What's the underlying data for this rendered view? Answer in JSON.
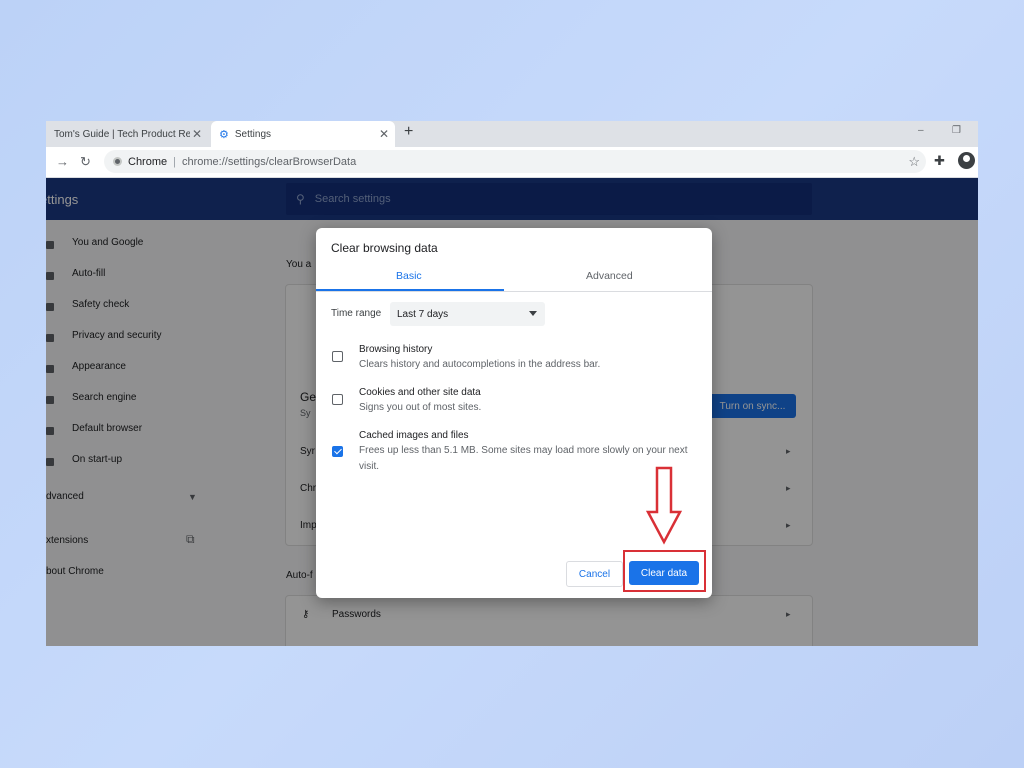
{
  "tabs": [
    {
      "label": "Tom's Guide | Tech Product Revie",
      "close": "✕"
    },
    {
      "label": "Settings",
      "close": "✕"
    }
  ],
  "new_tab": "+",
  "window_controls": {
    "minimize": "–",
    "restore": "❐"
  },
  "omnibox": {
    "site": "Chrome",
    "separator": "|",
    "url": "chrome://settings/clearBrowserData"
  },
  "settings": {
    "title": "ettings",
    "search_placeholder": "Search settings",
    "nav": [
      {
        "label": "You and Google"
      },
      {
        "label": "Auto-fill"
      },
      {
        "label": "Safety check"
      },
      {
        "label": "Privacy and security"
      },
      {
        "label": "Appearance"
      },
      {
        "label": "Search engine"
      },
      {
        "label": "Default browser"
      },
      {
        "label": "On start-up"
      }
    ],
    "advanced": "dvanced",
    "extensions": "xtensions",
    "about": "bout Chrome",
    "section_you": "You a",
    "card_title": "Ge",
    "card_sub": "Sy",
    "row1": "Syr",
    "row2": "Chr",
    "row3": "Imp",
    "sync_button": "Turn on sync...",
    "autofill_header": "Auto-f",
    "passwords": "Passwords"
  },
  "dialog": {
    "title": "Clear browsing data",
    "tab_basic": "Basic",
    "tab_advanced": "Advanced",
    "time_range_label": "Time range",
    "time_range_value": "Last 7 days",
    "options": [
      {
        "title": "Browsing history",
        "desc": "Clears history and autocompletions in the address bar.",
        "checked": false
      },
      {
        "title": "Cookies and other site data",
        "desc": "Signs you out of most sites.",
        "checked": false
      },
      {
        "title": "Cached images and files",
        "desc": "Frees up less than 5.1 MB. Some sites may load more slowly on your next visit.",
        "checked": true
      }
    ],
    "cancel": "Cancel",
    "clear": "Clear data"
  },
  "colors": {
    "accent": "#1a73e8",
    "header": "#1a3a86",
    "highlight": "#d93036"
  }
}
